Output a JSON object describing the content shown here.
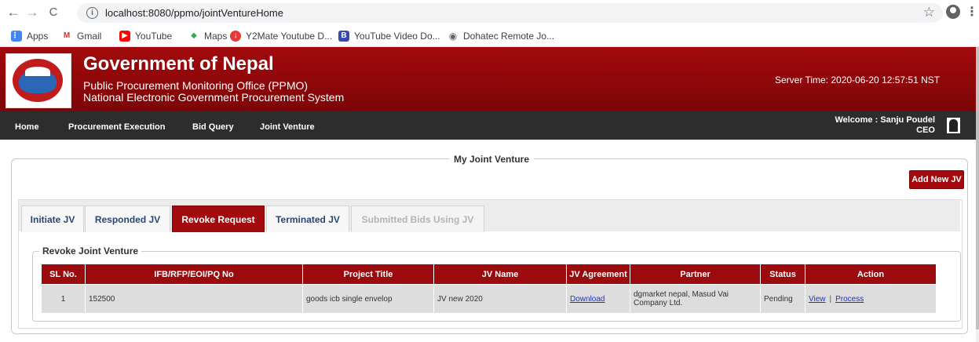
{
  "browser": {
    "back_glyph": "←",
    "forward_glyph": "→",
    "reload_glyph": "C",
    "url": "localhost:8080/ppmo/jointVentureHome",
    "star_glyph": "☆",
    "menu_glyph": "⋮",
    "info_glyph": "i",
    "bookmarks": [
      {
        "label": "Apps",
        "icon": "apps-grid-icon",
        "glyph": "⋮⋮",
        "color": "#4285f4"
      },
      {
        "label": "Gmail",
        "icon": "gmail-icon",
        "glyph": "M",
        "color": "#d93025"
      },
      {
        "label": "YouTube",
        "icon": "youtube-icon",
        "glyph": "▶",
        "color": "#ff0000"
      },
      {
        "label": "Maps",
        "icon": "maps-icon",
        "glyph": "◆",
        "color": "#34a853"
      },
      {
        "label": "Y2Mate Youtube D...",
        "icon": "y2mate-icon",
        "glyph": "↓",
        "color": "#e53935"
      },
      {
        "label": "YouTube Video Do...",
        "icon": "bookmark-b-icon",
        "glyph": "B",
        "color": "#3949ab"
      },
      {
        "label": "Dohatec Remote Jo...",
        "icon": "globe-icon",
        "glyph": "◉",
        "color": "#5f6368"
      }
    ]
  },
  "header": {
    "title": "Government of Nepal",
    "subtitle_1": "Public Procurement Monitoring Office (PPMO)",
    "subtitle_2": "National Electronic Government Procurement System",
    "server_time": "Server Time: 2020-06-20 12:57:51 NST"
  },
  "menu": {
    "items": [
      "Home",
      "Procurement Execution",
      "Bid Query",
      "Joint Venture"
    ],
    "welcome": "Welcome : Sanju Poudel",
    "role": "CEO"
  },
  "main": {
    "legend": "My Joint Venture",
    "add_button": "Add New JV",
    "tabs": [
      {
        "label": "Initiate JV",
        "state": "normal"
      },
      {
        "label": "Responded JV",
        "state": "normal"
      },
      {
        "label": "Revoke Request",
        "state": "active"
      },
      {
        "label": "Terminated JV",
        "state": "normal"
      },
      {
        "label": "Submitted Bids Using JV",
        "state": "disabled"
      }
    ],
    "section_legend": "Revoke Joint Venture",
    "table": {
      "headers": [
        "SL No.",
        "IFB/RFP/EOI/PQ No",
        "Project Title",
        "JV Name",
        "JV Agreement",
        "Partner",
        "Status",
        "Action"
      ],
      "rows": [
        {
          "sl": "1",
          "ifb": "152500",
          "project": "goods icb single envelop",
          "jv_name": "JV new 2020",
          "agreement": "Download",
          "partner": "dgmarket nepal, Masud Vai Company Ltd.",
          "status": "Pending",
          "action_view": "View",
          "action_sep": "|",
          "action_process": "Process"
        }
      ]
    }
  },
  "colors": {
    "brand_red": "#a30a0d",
    "menu_dark": "#2d2d2d",
    "table_header": "#9b0b0d",
    "link_blue": "#1a33cc"
  }
}
